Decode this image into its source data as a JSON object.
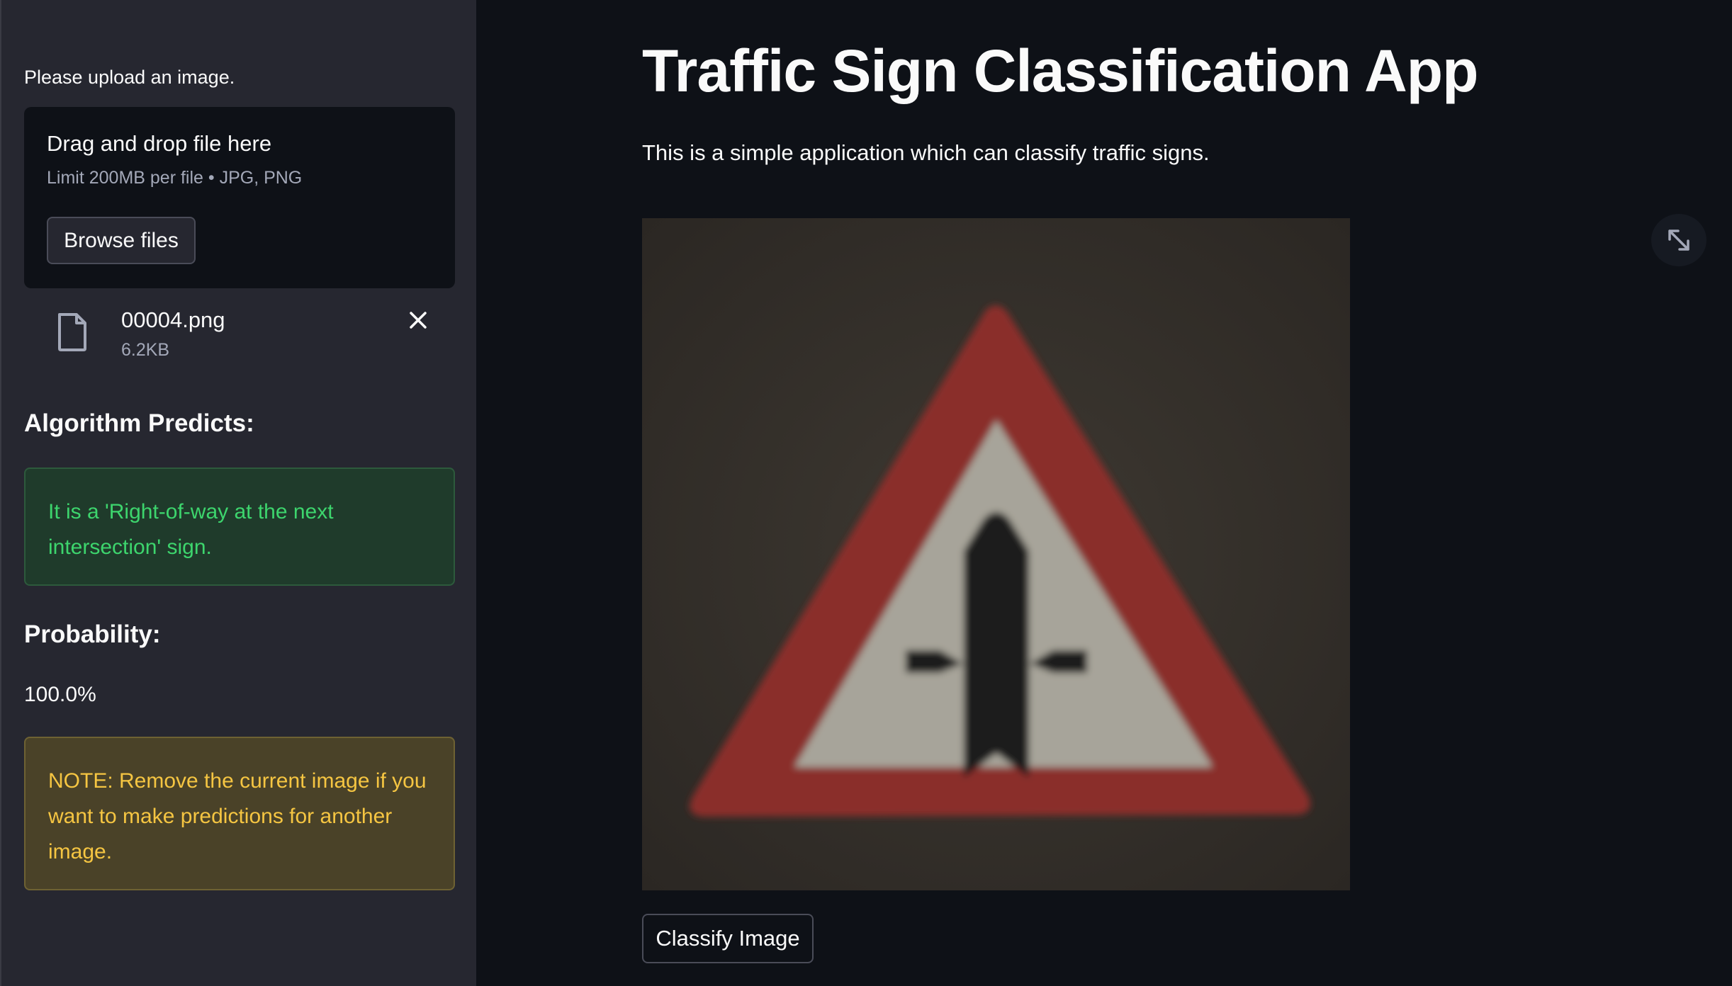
{
  "sidebar": {
    "upload_label": "Please upload an image.",
    "dropzone": {
      "title": "Drag and drop file here",
      "limit": "Limit 200MB per file • JPG, PNG",
      "browse_label": "Browse files"
    },
    "file": {
      "name": "00004.png",
      "size": "6.2KB",
      "icon": "file-icon",
      "remove_icon": "close-icon"
    },
    "predicts_heading": "Algorithm Predicts:",
    "prediction_text": "It is a 'Right-of-way at the next intersection' sign.",
    "probability_heading": "Probability:",
    "probability_value": "100.0%",
    "note_text": "NOTE: Remove the current image if you want to make predictions for another image."
  },
  "main": {
    "title": "Traffic Sign Classification App",
    "subtitle": "This is a simple application which can classify traffic signs.",
    "fullscreen_icon": "expand-icon",
    "classify_label": "Classify Image"
  },
  "colors": {
    "background": "#0e1117",
    "sidebar": "#262730",
    "success_text": "#3dd56d",
    "warning_text": "#f5c542"
  }
}
